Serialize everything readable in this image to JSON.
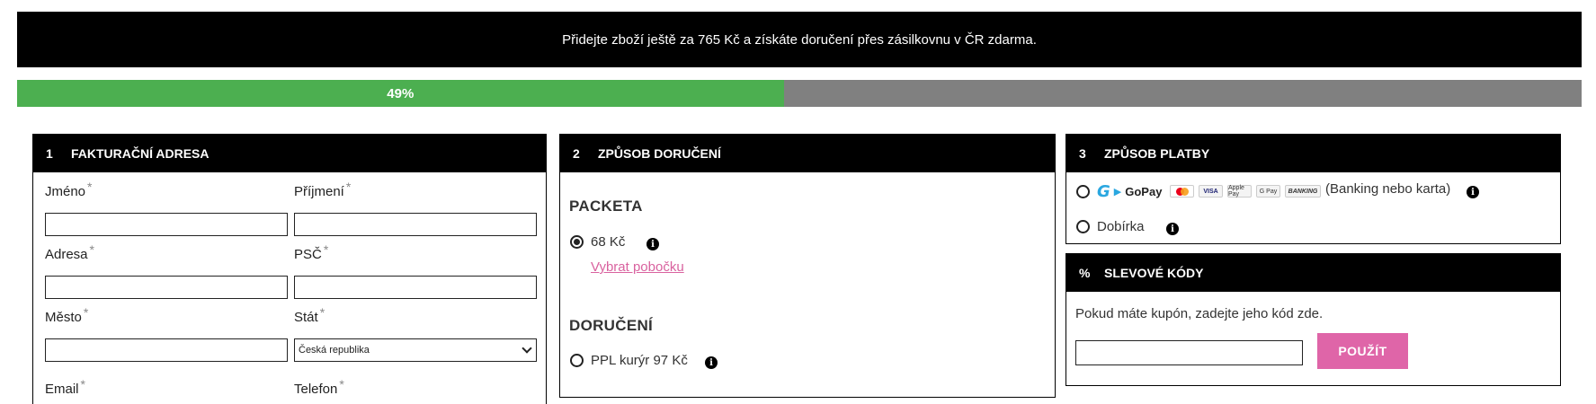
{
  "banner": {
    "text": "Přidejte zboží ještě za 765  Kč a získáte doručení přes zásilkovnu v ČR zdarma."
  },
  "progress": {
    "value_percent": 49,
    "label": "49%",
    "fill_color": "#4caf50",
    "track_color": "#808080"
  },
  "billing": {
    "number": "1",
    "title": "FAKTURAČNÍ ADRESA",
    "required_mark": "*",
    "fields": {
      "first_name": "Jméno",
      "last_name": "Příjmení",
      "address": "Adresa",
      "zip": "PSČ",
      "city": "Město",
      "country": "Stát",
      "email": "Email",
      "phone": "Telefon"
    },
    "country_selected": "Česká republika"
  },
  "delivery": {
    "number": "2",
    "title": "ZPŮSOB DORUČENÍ",
    "packeta": {
      "heading": "PACKETA",
      "option_text": "68  Kč",
      "selected": true,
      "branch_link": "Vybrat pobočku"
    },
    "courier": {
      "heading": "DORUČENÍ",
      "option_text": "PPL kurýr 97  Kč",
      "selected": false
    }
  },
  "payment": {
    "number": "3",
    "title": "ZPŮSOB PLATBY",
    "gopay": {
      "logo_text": "GoPay",
      "badges": [
        "mastercard",
        "VISA",
        "Apple Pay",
        "G Pay",
        "BANKING"
      ],
      "description": "(Banking nebo karta)"
    },
    "cod": {
      "label": "Dobírka"
    }
  },
  "coupons": {
    "icon": "%",
    "title": "SLEVOVÉ KÓDY",
    "text": "Pokud máte kupón, zadejte jeho kód zde.",
    "button": "POUŽÍT",
    "button_color": "#df65a8"
  },
  "icons": {
    "info": "i"
  }
}
